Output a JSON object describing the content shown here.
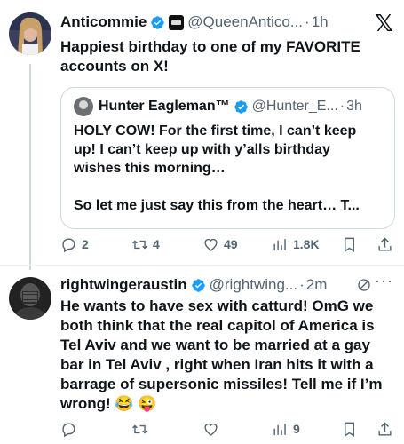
{
  "tweet1": {
    "name": "Anticommie",
    "handle": "@QueenAntico...",
    "dot": "·",
    "time": "1h",
    "text_line1": "Happiest birthday to one of my FAVORITE",
    "text_line2": "accounts on X!",
    "quote": {
      "name": "Hunter Eagleman™",
      "handle": "@Hunter_E...",
      "dot": "·",
      "time": "3h",
      "line1": "HOLY COW!  For the first time, I can’t keep",
      "line2": "up!  I can’t keep up with y’alls birthday",
      "line3": "wishes this morning…",
      "line4": "So let me just say this from the heart… T..."
    },
    "actions": {
      "replies": "2",
      "reposts": "4",
      "likes": "49",
      "views": "1.8K"
    }
  },
  "tweet2": {
    "name": "rightwingeraustin",
    "handle": "@rightwing...",
    "dot": "·",
    "time": "2m",
    "lines": [
      "He wants to have sex with catturd!  OmG we",
      "both think that the real capitol of America is",
      "Tel Aviv and we want to be married at a gay",
      "bar in  Tel Aviv , right when Iran hits it with a",
      "barrage of supersonic missiles!  Tell me if I’m",
      "wrong! 😂 😜"
    ],
    "actions": {
      "views": "9"
    }
  },
  "icons": {
    "verified_color": "#1d9bf0",
    "x_logo": "𝕏"
  }
}
